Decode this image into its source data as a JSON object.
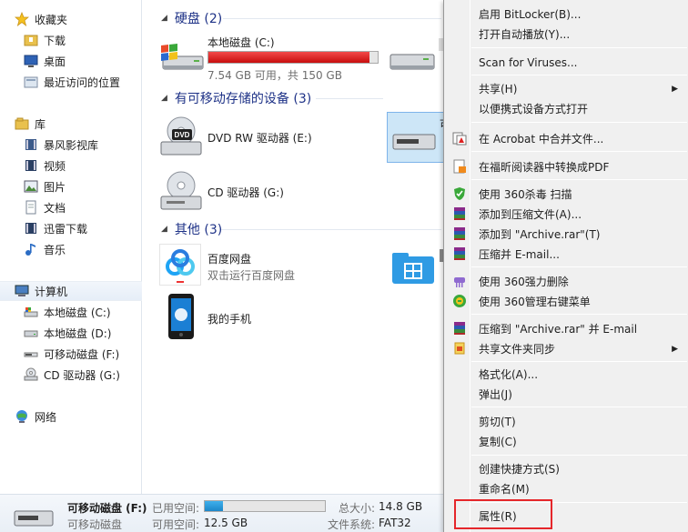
{
  "sidebar": {
    "favorites": {
      "label": "收藏夹",
      "items": [
        "下载",
        "桌面",
        "最近访问的位置"
      ]
    },
    "libraries": {
      "label": "库",
      "items": [
        "暴风影视库",
        "视频",
        "图片",
        "文档",
        "迅雷下载",
        "音乐"
      ]
    },
    "computer": {
      "label": "计算机",
      "items": [
        "本地磁盘 (C:)",
        "本地磁盘 (D:)",
        "可移动磁盘 (F:)",
        "CD 驱动器 (G:)"
      ]
    },
    "network": {
      "label": "网络"
    }
  },
  "main": {
    "groups": {
      "hdd": {
        "title": "硬盘 (2)"
      },
      "removable": {
        "title": "有可移动存储的设备 (3)"
      },
      "other": {
        "title": "其他 (3)"
      }
    },
    "drive_c": {
      "name": "本地磁盘 (C:)",
      "free_text": "7.54 GB 可用，共 150 GB",
      "used_fraction": 0.95
    },
    "dvd": {
      "name": "DVD RW 驱动器 (E:)"
    },
    "cd": {
      "name": "CD 驱动器 (G:)"
    },
    "baidu": {
      "name": "百度网盘",
      "sub": "双击运行百度网盘"
    },
    "phone": {
      "name": "我的手机"
    },
    "partial_label": "可"
  },
  "context_menu": {
    "items": [
      "启用 BitLocker(B)...",
      "打开自动播放(Y)...",
      "Scan for Viruses...",
      "共享(H)",
      "以便携式设备方式打开",
      "在 Acrobat 中合并文件...",
      "在福昕阅读器中转换成PDF",
      "使用 360杀毒 扫描",
      "添加到压缩文件(A)...",
      "添加到 \"Archive.rar\"(T)",
      "压缩并 E-mail...",
      "使用 360强力删除",
      "使用 360管理右键菜单",
      "压缩到 \"Archive.rar\" 并 E-mail",
      "共享文件夹同步",
      "格式化(A)...",
      "弹出(J)",
      "剪切(T)",
      "复制(C)",
      "创建快捷方式(S)",
      "重命名(M)",
      "属性(R)"
    ]
  },
  "status": {
    "name": "可移动磁盘 (F:)",
    "type": "可移动磁盘",
    "used_label": "已用空间:",
    "used_fraction": 0.15,
    "free_label": "可用空间:",
    "free_value": "12.5 GB",
    "total_label": "总大小:",
    "total_value": "14.8 GB",
    "fs_label": "文件系统:",
    "fs_value": "FAT32"
  },
  "colors": {
    "accent": "#1e3287",
    "highlight_border": "#e5262a",
    "capacity_red": "#d11515",
    "capacity_blue": "#2a9ad8"
  }
}
